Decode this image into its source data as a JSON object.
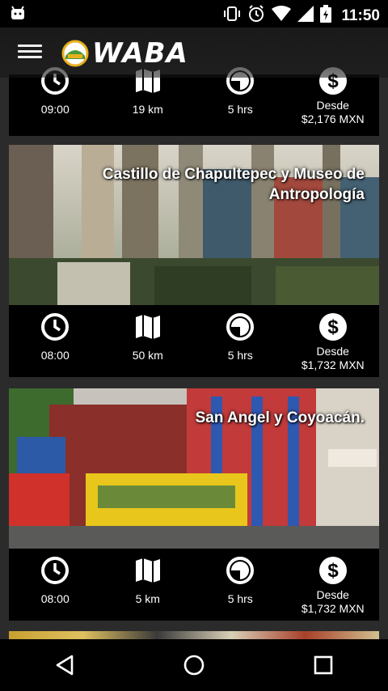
{
  "status_bar": {
    "time": "11:50"
  },
  "app": {
    "logo_text": "WABA",
    "menu_icon": "hamburger-menu-icon"
  },
  "tours": [
    {
      "title": "",
      "time": "09:00",
      "distance": "19 km",
      "duration": "5 hrs",
      "price_line1": "Desde",
      "price_line2": "$2,176 MXN"
    },
    {
      "title": "Castillo de Chapultepec y Museo de Antropología",
      "time": "08:00",
      "distance": "50 km",
      "duration": "5 hrs",
      "price_line1": "Desde",
      "price_line2": "$1,732 MXN"
    },
    {
      "title": "San Angel y Coyoacán.",
      "time": "08:00",
      "distance": "5 km",
      "duration": "5 hrs",
      "price_line1": "Desde",
      "price_line2": "$1,732 MXN"
    }
  ],
  "icons": {
    "time": "clock-icon",
    "distance": "map-icon",
    "duration": "timer-icon",
    "price": "dollar-icon"
  },
  "colors": {
    "background": "#2b2b2b",
    "card": "#000000",
    "text": "#ffffff"
  }
}
